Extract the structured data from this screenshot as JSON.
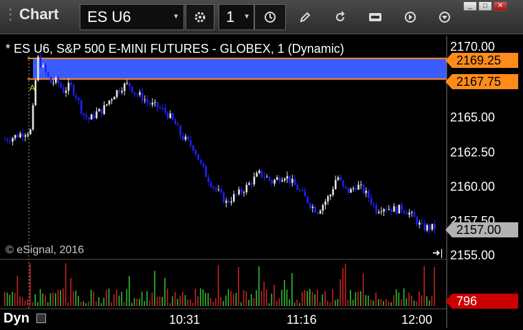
{
  "toolbar": {
    "title": "Chart",
    "symbol": "ES U6",
    "interval": "1"
  },
  "chart": {
    "title": "* ES U6, S&P 500 E-MINI FUTURES - GLOBEX, 1 (Dynamic)",
    "copyright": "© eSignal, 2016",
    "mode_label": "Dyn",
    "zone_marker": "A",
    "price_tag_top": "2169.25",
    "price_tag_bottom": "2167.75",
    "last_price": "2157.00",
    "last_volume": "796",
    "colors": {
      "zone": "#3a5cff",
      "zone_border": "#ff8c1a",
      "down_candle": "#1f1fff",
      "up_candle": "#e6e6e6",
      "volume_tag": "#cc0000",
      "price_tag": "#ff8c1a",
      "last_tag": "#b3b3b3"
    }
  },
  "chart_data": {
    "type": "candlestick",
    "y_axis": {
      "ticks": [
        "2170.00",
        "2165.00",
        "2162.50",
        "2160.00",
        "2157.50",
        "2155.00"
      ],
      "ylim": [
        2155.0,
        2170.5
      ]
    },
    "x_axis": {
      "ticks": [
        "10:31",
        "11:16",
        "12:00"
      ]
    },
    "zone": {
      "low": 2167.75,
      "high": 2169.25
    },
    "close_path": [
      2163.4,
      2163.5,
      2163.7,
      2163.9,
      2164.0,
      2169.3,
      2168.4,
      2167.5,
      2167.6,
      2166.9,
      2167.3,
      2166.5,
      2165.2,
      2164.8,
      2165.3,
      2165.5,
      2166.2,
      2166.8,
      2167.2,
      2167.4,
      2166.7,
      2166.5,
      2166.0,
      2165.8,
      2165.6,
      2165.2,
      2164.6,
      2163.7,
      2163.2,
      2162.8,
      2161.6,
      2160.7,
      2160.0,
      2159.4,
      2158.8,
      2159.2,
      2159.5,
      2159.9,
      2160.4,
      2160.9,
      2160.7,
      2160.3,
      2160.6,
      2160.8,
      2160.3,
      2159.8,
      2159.2,
      2158.6,
      2158.2,
      2158.8,
      2159.4,
      2160.8,
      2159.8,
      2159.6,
      2160.1,
      2159.7,
      2159.1,
      2158.3,
      2158.5,
      2158.4,
      2158.3,
      2158.4,
      2158.1,
      2157.6,
      2157.0,
      2157.0,
      2157.0
    ]
  }
}
